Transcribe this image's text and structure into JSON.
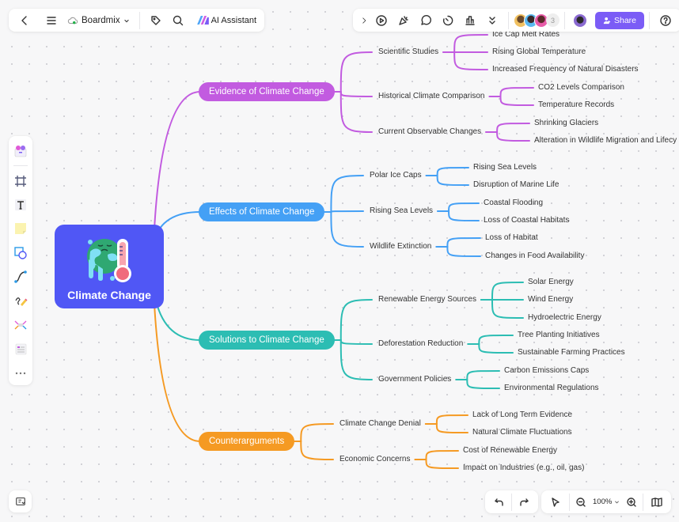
{
  "topbar": {
    "back_icon": "chevron-left-icon",
    "menu_icon": "hamburger-menu-icon",
    "brand_label": "Boardmix",
    "tag_icon": "tag-icon",
    "search_icon": "search-icon",
    "ai_label": "AI Assistant",
    "right_tools": [
      "expand",
      "present",
      "celebrate",
      "comment",
      "timer",
      "vote",
      "more"
    ],
    "collaborator_count": "3",
    "share_label": "Share",
    "help_icon": "help-icon"
  },
  "left_toolbar": {
    "items": [
      "templates",
      "frame",
      "text",
      "sticky-note",
      "shape",
      "connector",
      "pen",
      "mind-map",
      "table",
      "more"
    ]
  },
  "bottom": {
    "zoom_level": "100%"
  },
  "colors": {
    "root": "#5057f5",
    "evidence": "#c25be0",
    "effects": "#44a0f5",
    "solutions": "#2cbdb3",
    "counter": "#f59a23",
    "share": "#7b5cf6"
  },
  "mindmap": {
    "root": "Climate Change",
    "branches": [
      {
        "label": "Evidence of Climate Change",
        "children": [
          {
            "label": "Scientific Studies",
            "children": [
              "Ice Cap Melt Rates",
              "Rising Global Temperature",
              "Increased Frequency of Natural Disasters"
            ]
          },
          {
            "label": "Historical Climate Comparison",
            "children": [
              "CO2 Levels Comparison",
              "Temperature Records"
            ]
          },
          {
            "label": "Current Observable Changes",
            "children": [
              "Shrinking Glaciers",
              "Alteration in Wildlife Migration and Lifecy"
            ]
          }
        ]
      },
      {
        "label": "Effects of Climate Change",
        "children": [
          {
            "label": "Polar Ice Caps",
            "children": [
              "Rising Sea Levels",
              "Disruption of Marine Life"
            ]
          },
          {
            "label": "Rising Sea Levels",
            "children": [
              "Coastal Flooding",
              "Loss of Coastal Habitats"
            ]
          },
          {
            "label": "Wildlife Extinction",
            "children": [
              "Loss of Habitat",
              "Changes in Food Availability"
            ]
          }
        ]
      },
      {
        "label": "Solutions to Climate Change",
        "children": [
          {
            "label": "Renewable Energy Sources",
            "children": [
              "Solar Energy",
              "Wind Energy",
              "Hydroelectric Energy"
            ]
          },
          {
            "label": "Deforestation Reduction",
            "children": [
              "Tree Planting Initiatives",
              "Sustainable Farming Practices"
            ]
          },
          {
            "label": "Government Policies",
            "children": [
              "Carbon Emissions Caps",
              "Environmental Regulations"
            ]
          }
        ]
      },
      {
        "label": "Counterarguments",
        "children": [
          {
            "label": "Climate Change Denial",
            "children": [
              "Lack of Long Term Evidence",
              "Natural Climate Fluctuations"
            ]
          },
          {
            "label": "Economic Concerns",
            "children": [
              "Cost of Renewable Energy",
              "Impact on Industries (e.g., oil, gas)"
            ]
          }
        ]
      }
    ]
  }
}
